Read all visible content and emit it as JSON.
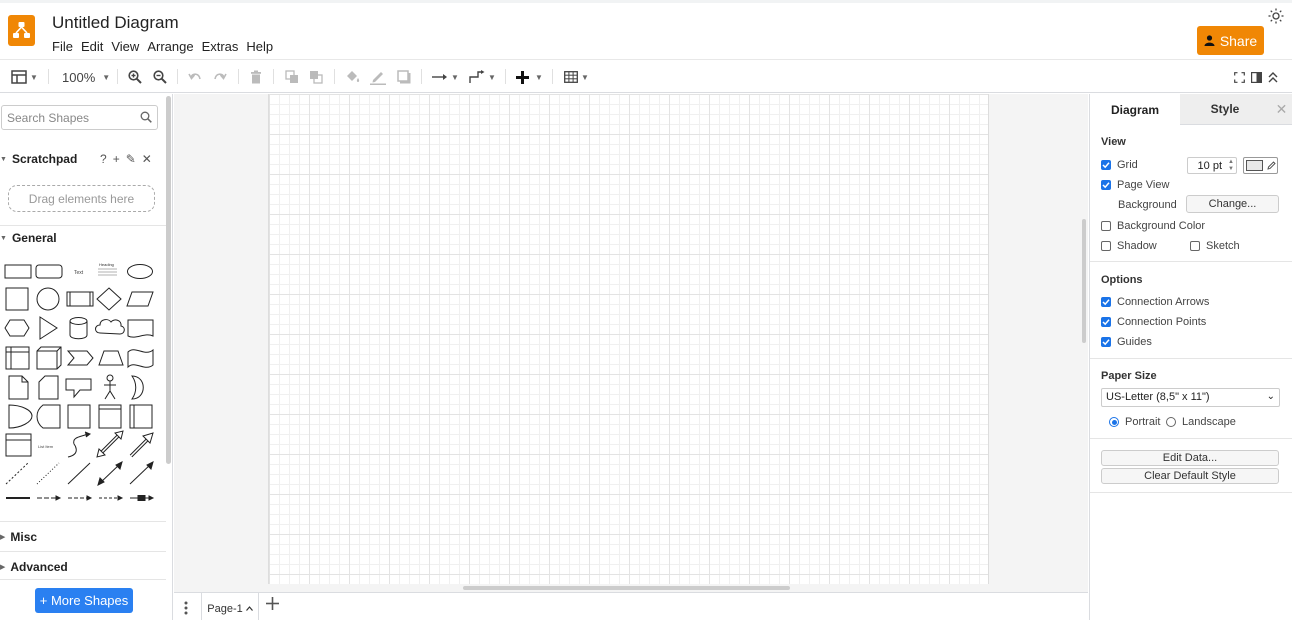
{
  "header": {
    "title": "Untitled Diagram",
    "menu": [
      "File",
      "Edit",
      "View",
      "Arrange",
      "Extras",
      "Help"
    ],
    "share_label": "Share",
    "brand_color": "#f08705"
  },
  "toolbar": {
    "zoom": "100%"
  },
  "left": {
    "search_placeholder": "Search Shapes",
    "scratchpad_title": "Scratchpad",
    "scratchpad_tools": [
      "?",
      "+",
      "✎",
      "✕"
    ],
    "drop_hint": "Drag elements here",
    "general_title": "General",
    "shape_text": "Text",
    "shape_heading": "Heading",
    "shape_list_item": "List Item",
    "misc_title": "Misc",
    "advanced_title": "Advanced",
    "more_shapes": "+ More Shapes"
  },
  "pages": {
    "current": "Page-1"
  },
  "right": {
    "tab_diagram": "Diagram",
    "tab_style": "Style",
    "view_title": "View",
    "grid_label": "Grid",
    "grid_size": "10 pt",
    "page_view_label": "Page View",
    "background_label": "Background",
    "change_label": "Change...",
    "bg_color_label": "Background Color",
    "shadow_label": "Shadow",
    "sketch_label": "Sketch",
    "options_title": "Options",
    "conn_arrows": "Connection Arrows",
    "conn_points": "Connection Points",
    "guides": "Guides",
    "paper_title": "Paper Size",
    "paper_value": "US-Letter (8,5\" x 11\")",
    "portrait": "Portrait",
    "landscape": "Landscape",
    "edit_data": "Edit Data...",
    "clear_style": "Clear Default Style",
    "checked_color": "#1a73e8"
  }
}
